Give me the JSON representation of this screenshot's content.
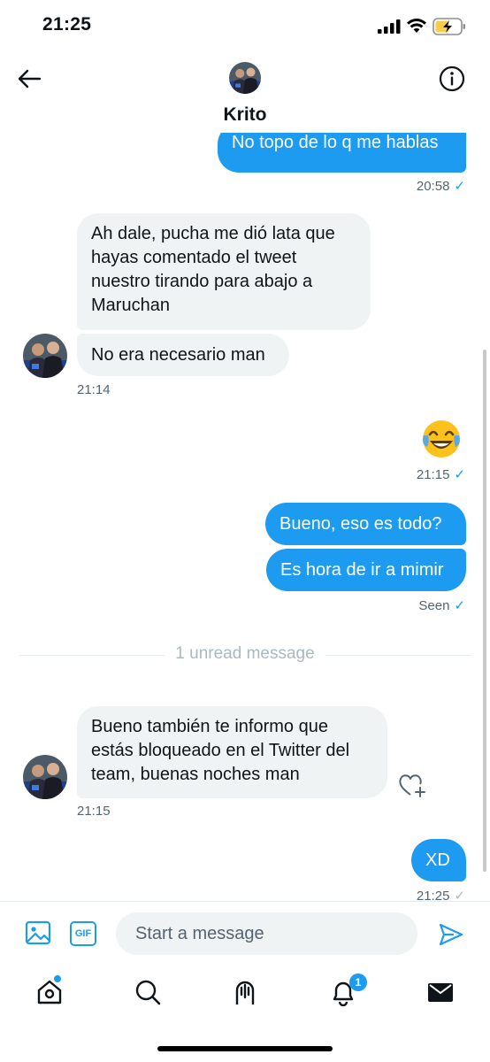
{
  "status_bar": {
    "time": "21:25"
  },
  "header": {
    "contact_name": "Krito"
  },
  "messages": [
    {
      "text": "No topo de lo q me hablas",
      "time": "20:58"
    },
    {
      "text": "Ah dale, pucha me dió lata que hayas comentado el tweet nuestro tirando para abajo a Maruchan"
    },
    {
      "text": "No era necesario man",
      "time": "21:14"
    },
    {
      "text": "😂",
      "time": "21:15"
    },
    {
      "text": "Bueno, eso es todo?"
    },
    {
      "text": "Es hora de ir a mimir",
      "status": "Seen"
    },
    {
      "text": "Bueno también te informo que estás bloqueado en el Twitter del team, buenas noches man",
      "time": "21:15"
    },
    {
      "text": "XD",
      "time": "21:25"
    }
  ],
  "divider": {
    "label": "1 unread message"
  },
  "composer": {
    "placeholder": "Start a message",
    "gif_label": "GIF"
  },
  "nav": {
    "notifications_badge": "1"
  },
  "colors": {
    "accent": "#1d9bf0",
    "incoming_bubble": "#eff3f4",
    "muted_text": "#536471"
  },
  "icons": [
    "back-arrow-icon",
    "info-icon",
    "heart-plus-icon",
    "image-icon",
    "gif-icon",
    "send-icon",
    "home-icon",
    "search-icon",
    "spaces-icon",
    "bell-icon",
    "mail-icon"
  ]
}
